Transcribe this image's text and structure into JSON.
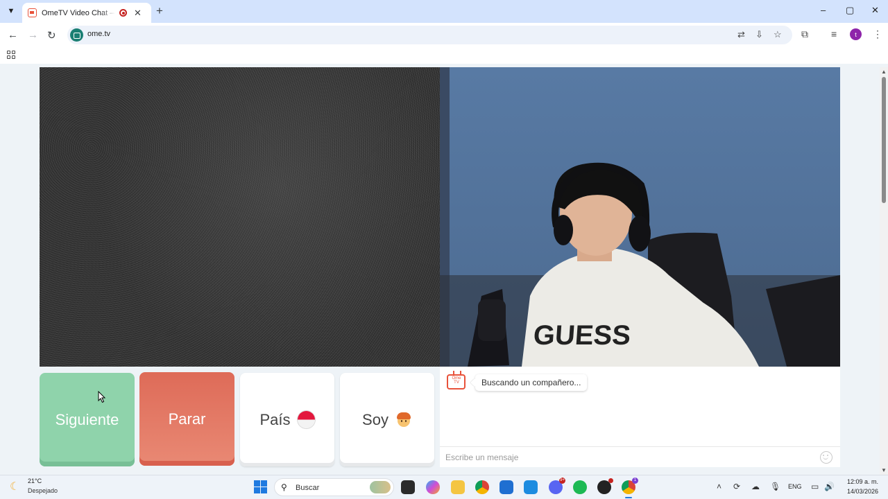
{
  "browser": {
    "tab_title": "OmeTV Video Chat — Omegle Alternative",
    "new_tab": "+",
    "url": "ome.tv",
    "window_controls": [
      "–",
      "▢",
      "✕"
    ]
  },
  "icons": {
    "tab_menu": "chevron-down-icon",
    "favicon": "ometv-favicon-icon",
    "recording": "recording-icon",
    "back": "back-arrow-icon",
    "forward": "forward-arrow-icon",
    "reload": "reload-icon",
    "translate": "translate-icon",
    "install": "install-app-icon",
    "bookmark": "star-icon",
    "extensions": "puzzle-icon",
    "media": "media-controls-icon",
    "menu": "kebab-menu-icon",
    "apps": "apps-grid-icon"
  },
  "profile_initial": "t",
  "chat": {
    "status_message": "Buscando un compañero...",
    "input_placeholder": "Escribe un mensaje",
    "logo_text": "Ome TV"
  },
  "controls": {
    "next_label": "Siguiente",
    "stop_label": "Parar",
    "country_label": "País",
    "gender_label": "Soy"
  },
  "colors": {
    "next_button": "#8fd3ab",
    "stop_button": "#e27a66",
    "brand": "#e8523a"
  },
  "taskbar": {
    "temperature": "21°C",
    "condition": "Despejado",
    "search_placeholder": "Buscar",
    "language": "ENG",
    "time": "12:09 a. m.",
    "date": "14/03/2026",
    "discord_badge": "9+",
    "chrome_badge": "1"
  }
}
